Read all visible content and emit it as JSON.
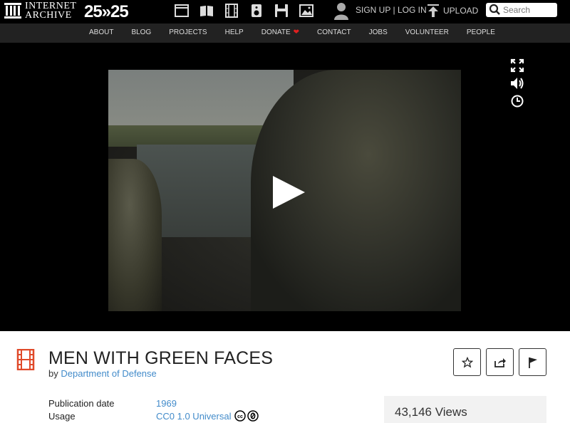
{
  "header": {
    "logo_line1": "INTERNET",
    "logo_line2": "ARCHIVE",
    "anniversary": "25»25",
    "media_icons": [
      "web-icon",
      "texts-icon",
      "video-icon",
      "audio-icon",
      "software-icon",
      "images-icon"
    ],
    "signup": "SIGN UP",
    "separator": "|",
    "login": "LOG IN",
    "upload": "UPLOAD",
    "search_placeholder": "Search"
  },
  "nav": {
    "items": [
      "ABOUT",
      "BLOG",
      "PROJECTS",
      "HELP",
      "DONATE",
      "CONTACT",
      "JOBS",
      "VOLUNTEER",
      "PEOPLE"
    ]
  },
  "player": {
    "controls": [
      "fullscreen-icon",
      "volume-icon",
      "clock-icon"
    ]
  },
  "item": {
    "title": "MEN WITH GREEN FACES",
    "by": "by",
    "creator": "Department of Defense",
    "metadata": [
      {
        "label": "Publication date",
        "value": "1969"
      },
      {
        "label": "Usage",
        "value": "CC0 1.0 Universal"
      }
    ],
    "views": "43,146 Views",
    "actions": [
      "favorite-icon",
      "share-icon",
      "flag-icon"
    ]
  },
  "colors": {
    "link": "#428bca",
    "accent": "#e04a2a",
    "topbar": "#000000",
    "navbar": "#222222"
  }
}
